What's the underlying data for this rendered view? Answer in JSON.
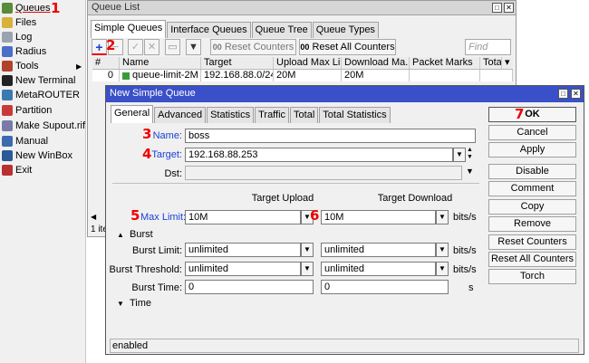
{
  "sidebar": {
    "items": [
      {
        "label": "Queues",
        "icon": "queues-icon",
        "color": "#5a8a3a"
      },
      {
        "label": "Files",
        "icon": "folder-icon",
        "color": "#d8b03a"
      },
      {
        "label": "Log",
        "icon": "log-icon",
        "color": "#9aa4b0"
      },
      {
        "label": "Radius",
        "icon": "radius-icon",
        "color": "#4a6ec8"
      },
      {
        "label": "Tools",
        "icon": "tools-icon",
        "color": "#b0442a"
      },
      {
        "label": "New Terminal",
        "icon": "terminal-icon",
        "color": "#222222"
      },
      {
        "label": "MetaROUTER",
        "icon": "metarouter-icon",
        "color": "#3a7ab0"
      },
      {
        "label": "Partition",
        "icon": "partition-icon",
        "color": "#c83a3a"
      },
      {
        "label": "Make Supout.rif",
        "icon": "supout-icon",
        "color": "#7a7aa8"
      },
      {
        "label": "Manual",
        "icon": "manual-icon",
        "color": "#3a6ab0"
      },
      {
        "label": "New WinBox",
        "icon": "winbox-icon",
        "color": "#2a5a98"
      },
      {
        "label": "Exit",
        "icon": "exit-icon",
        "color": "#b83030"
      }
    ]
  },
  "markers": [
    "1",
    "2",
    "3",
    "4",
    "5",
    "6",
    "7"
  ],
  "queue_list": {
    "title": "Queue List",
    "tabs": [
      "Simple Queues",
      "Interface Queues",
      "Queue Tree",
      "Queue Types"
    ],
    "add_glyph": "+",
    "remove_glyph": "−",
    "enable_glyph": "✓",
    "disable_glyph": "✕",
    "comment_glyph": "▭",
    "filter_glyph": "▼",
    "reset_counters": "Reset Counters",
    "reset_all_counters": "Reset All Counters",
    "find_placeholder": "Find",
    "columns": [
      "#",
      "Name",
      "Target",
      "Upload Max Li...",
      "Download Ma...",
      "Packet Marks",
      "Tota"
    ],
    "row": {
      "num": "0",
      "name": "queue-limit-2M",
      "target": "192.168.88.0/24",
      "upload": "20M",
      "download": "20M",
      "marks": "",
      "total": ""
    },
    "items_count": "1 ite"
  },
  "dialog": {
    "title": "New Simple Queue",
    "tabs": [
      "General",
      "Advanced",
      "Statistics",
      "Traffic",
      "Total",
      "Total Statistics"
    ],
    "name_label": "Name:",
    "name_value": "boss",
    "target_label": "Target:",
    "target_value": "192.168.88.253",
    "dst_label": "Dst:",
    "dst_value": "",
    "target_upload_header": "Target Upload",
    "target_download_header": "Target Download",
    "max_limit_label": "Max Limit:",
    "max_limit_upload": "10M",
    "max_limit_download": "10M",
    "burst_section": "Burst",
    "burst_limit_label": "Burst Limit:",
    "burst_limit_upload": "unlimited",
    "burst_limit_download": "unlimited",
    "burst_threshold_label": "Burst Threshold:",
    "burst_threshold_upload": "unlimited",
    "burst_threshold_download": "unlimited",
    "burst_time_label": "Burst Time:",
    "burst_time_upload": "0",
    "burst_time_download": "0",
    "time_section": "Time",
    "unit_bits": "bits/s",
    "unit_s": "s",
    "buttons": [
      "OK",
      "Cancel",
      "Apply",
      "Disable",
      "Comment",
      "Copy",
      "Remove",
      "Reset Counters",
      "Reset All Counters",
      "Torch"
    ],
    "status": "enabled"
  }
}
